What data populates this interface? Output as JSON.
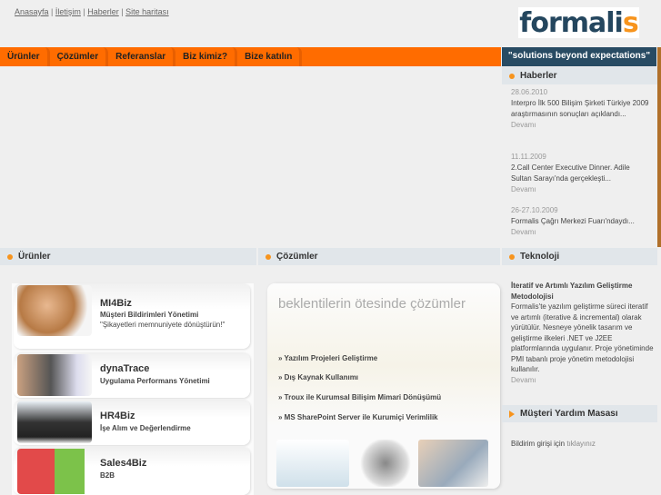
{
  "top_links": [
    "Anasayfa",
    "İletişim",
    "Haberler",
    "Site haritası"
  ],
  "logo": {
    "main": "formali",
    "accent": "s"
  },
  "nav": [
    "Ürünler",
    "Çözümler",
    "Referanslar",
    "Biz kimiz?",
    "Bize katılın"
  ],
  "slogan": "\"solutions beyond expectations\"",
  "news": {
    "title": "Haberler",
    "items": [
      {
        "date": "28.06.2010",
        "text": "Interpro İlk 500 Bilişim Şirketi Türkiye 2009 araştırmasının sonuçları açıklandı...",
        "more": "Devamı"
      },
      {
        "date": "11.11.2009",
        "text": "2.Call Center Executive Dinner. Adile Sultan Sarayı'nda gerçekleşti...",
        "more": "Devamı"
      },
      {
        "date": "26-27.10.2009",
        "text": "Formalis Çağrı Merkezi Fuarı'ndaydı...",
        "more": "Devamı"
      }
    ]
  },
  "products": {
    "title": "Ürünler",
    "items": [
      {
        "name": "MI4Biz",
        "subtitle": "Müşteri Bildirimleri Yönetimi",
        "quote": "\"Şikayetleri memnuniyete dönüştürün!\""
      },
      {
        "name": "dynaTrace",
        "subtitle": "Uygulama Performans Yönetimi"
      },
      {
        "name": "HR4Biz",
        "subtitle": "İşe Alım ve Değerlendirme"
      },
      {
        "name": "Sales4Biz",
        "subtitle": "B2B"
      }
    ]
  },
  "solutions": {
    "title": "Çözümler",
    "heading": "beklentilerin ötesinde çözümler",
    "items": [
      "» Yazılım Projeleri Geliştirme",
      "» Dış Kaynak Kullanımı",
      "» Troux ile Kurumsal Bilişim Mimari Dönüşümü",
      "» MS SharePoint Server ile Kurumiçi Verimlilik"
    ]
  },
  "technology": {
    "title": "Teknoloji",
    "heading": "İteratif ve Artımlı Yazılım Geliştirme Metodolojisi",
    "body": "Formalis'te yazılım geliştirme süreci iteratif ve artımlı (iterative & incremental) olarak yürütülür. Nesneye yönelik tasarım ve geliştirme ilkeleri .NET ve J2EE platformlarında uygulanır. Proje yönetiminde PMI tabanlı proje yönetim metodolojisi kullanılır.",
    "more": "Devamı"
  },
  "helpdesk": {
    "title": "Müşteri Yardım Masası",
    "text": "Bildirim girişi için ",
    "link": "tıklayınız"
  }
}
